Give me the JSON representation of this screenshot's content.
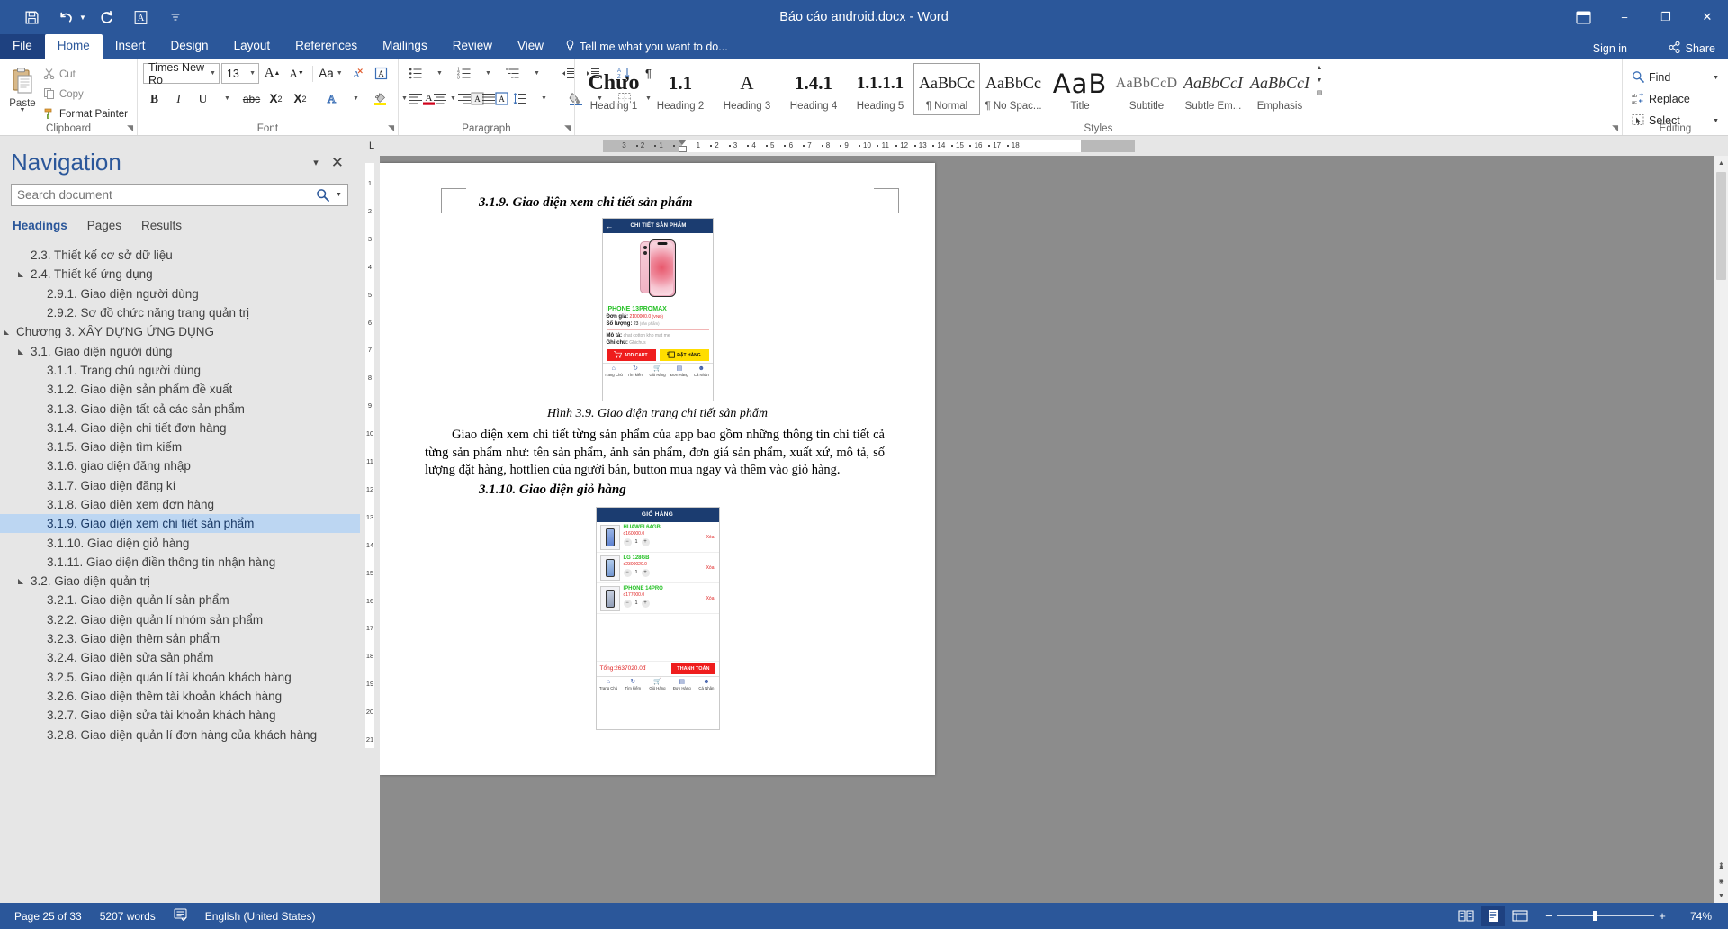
{
  "window": {
    "title": "Báo cáo android.docx - Word",
    "quick_access": [
      "save-icon",
      "undo-icon",
      "redo-icon",
      "style-a-icon",
      "customize-qat-icon"
    ],
    "ribbon_display_icon": "ribbon-display-options-icon",
    "minimize": "−",
    "restore": "❐",
    "close": "✕"
  },
  "tabs": {
    "items": [
      "File",
      "Home",
      "Insert",
      "Design",
      "Layout",
      "References",
      "Mailings",
      "Review",
      "View"
    ],
    "active": "Home",
    "tell_me": "Tell me what you want to do...",
    "sign_in": "Sign in",
    "share": "Share"
  },
  "ribbon": {
    "groups": [
      "Clipboard",
      "Font",
      "Paragraph",
      "Styles",
      "Editing"
    ],
    "clipboard": {
      "paste_label": "Paste",
      "cut": "Cut",
      "copy": "Copy",
      "format_painter": "Format Painter"
    },
    "font": {
      "font_name": "Times New Ro",
      "font_size": "13",
      "grow_font": "A",
      "shrink_font": "A",
      "change_case": "Aa",
      "clear_formatting": "clear-formatting-icon",
      "bold": "B",
      "italic": "I",
      "underline": "U",
      "strikethrough": "abc",
      "subscript": "X₂",
      "superscript": "X²",
      "text_effects": "A",
      "highlight": "ab",
      "font_color": "A",
      "char_shading": "A",
      "char_border": "A"
    },
    "paragraph": {
      "bullets": "bullets-icon",
      "numbering": "numbering-icon",
      "multilevel": "multilevel-list-icon",
      "decrease_indent": "decrease-indent-icon",
      "increase_indent": "increase-indent-icon",
      "sort": "sort-icon",
      "show_marks": "¶",
      "align_left": "align-left-icon",
      "align_center": "align-center-icon",
      "align_right": "align-right-icon",
      "justify": "justify-icon",
      "line_spacing": "line-spacing-icon",
      "shading": "shading-icon",
      "borders": "borders-icon"
    },
    "styles": [
      {
        "preview": "Chưo",
        "name": "Heading 1",
        "selected": false
      },
      {
        "preview": "1.1",
        "name": "Heading 2",
        "selected": false
      },
      {
        "preview": "A",
        "name": "Heading 3",
        "selected": false
      },
      {
        "preview": "1.4.1",
        "name": "Heading 4",
        "selected": false
      },
      {
        "preview": "1.1.1.1",
        "name": "Heading 5",
        "selected": false
      },
      {
        "preview": "AaBbCc",
        "name": "¶ Normal",
        "selected": true
      },
      {
        "preview": "AaBbCc",
        "name": "¶ No Spac...",
        "selected": false
      },
      {
        "preview": "AaB",
        "name": "Title",
        "selected": false
      },
      {
        "preview": "AaBbCcD",
        "name": "Subtitle",
        "selected": false
      },
      {
        "preview": "AaBbCcI",
        "name": "Subtle Em...",
        "selected": false
      },
      {
        "preview": "AaBbCcI",
        "name": "Emphasis",
        "selected": false
      }
    ],
    "editing": {
      "find": "Find",
      "replace": "Replace",
      "select": "Select"
    }
  },
  "navigation": {
    "title": "Navigation",
    "search_placeholder": "Search document",
    "search_value": "",
    "tabs": [
      "Headings",
      "Pages",
      "Results"
    ],
    "active_tab": "Headings",
    "items": [
      {
        "label": "2.3. Thiết kế cơ sở dữ liệu",
        "level": 2,
        "arrow": false,
        "selected": false
      },
      {
        "label": "2.4. Thiết kế ứng dụng",
        "level": 2,
        "arrow": true,
        "selected": false
      },
      {
        "label": "2.9.1. Giao diện người dùng",
        "level": 3,
        "arrow": false,
        "selected": false
      },
      {
        "label": "2.9.2. Sơ đồ chức năng trang quản trị",
        "level": 3,
        "arrow": false,
        "selected": false
      },
      {
        "label": "Chương 3. XÂY DỰNG ỨNG DỤNG",
        "level": 1,
        "arrow": true,
        "selected": false
      },
      {
        "label": "3.1. Giao diện người dùng",
        "level": 2,
        "arrow": true,
        "selected": false
      },
      {
        "label": "3.1.1. Trang chủ người dùng",
        "level": 3,
        "arrow": false,
        "selected": false
      },
      {
        "label": "3.1.2. Giao diện sản phẩm đề xuất",
        "level": 3,
        "arrow": false,
        "selected": false
      },
      {
        "label": "3.1.3. Giao diện tất cả các sản phẩm",
        "level": 3,
        "arrow": false,
        "selected": false
      },
      {
        "label": "3.1.4. Giao diện chi tiết đơn hàng",
        "level": 3,
        "arrow": false,
        "selected": false
      },
      {
        "label": "3.1.5. Giao diện tìm kiếm",
        "level": 3,
        "arrow": false,
        "selected": false
      },
      {
        "label": "3.1.6. giao diện đăng nhập",
        "level": 3,
        "arrow": false,
        "selected": false
      },
      {
        "label": "3.1.7. Giao diện đăng kí",
        "level": 3,
        "arrow": false,
        "selected": false
      },
      {
        "label": "3.1.8. Giao diện xem đơn hàng",
        "level": 3,
        "arrow": false,
        "selected": false
      },
      {
        "label": "3.1.9. Giao diện xem chi tiết sản phẩm",
        "level": 3,
        "arrow": false,
        "selected": true
      },
      {
        "label": "3.1.10. Giao diện giỏ hàng",
        "level": 3,
        "arrow": false,
        "selected": false
      },
      {
        "label": "3.1.11. Giao diện điền thông tin nhận hàng",
        "level": 3,
        "arrow": false,
        "selected": false
      },
      {
        "label": "3.2. Giao diện quản trị",
        "level": 2,
        "arrow": true,
        "selected": false
      },
      {
        "label": "3.2.1. Giao diện quản lí sản phẩm",
        "level": 3,
        "arrow": false,
        "selected": false
      },
      {
        "label": "3.2.2. Giao diện quản lí nhóm sản phẩm",
        "level": 3,
        "arrow": false,
        "selected": false
      },
      {
        "label": "3.2.3. Giao diện thêm sản phẩm",
        "level": 3,
        "arrow": false,
        "selected": false
      },
      {
        "label": "3.2.4. Giao diện sửa sản phẩm",
        "level": 3,
        "arrow": false,
        "selected": false
      },
      {
        "label": "3.2.5. Giao diện quản lí tài khoản khách hàng",
        "level": 3,
        "arrow": false,
        "selected": false
      },
      {
        "label": "3.2.6. Giao diện thêm tài khoản khách hàng",
        "level": 3,
        "arrow": false,
        "selected": false
      },
      {
        "label": "3.2.7. Giao diện sửa tài khoản khách hàng",
        "level": 3,
        "arrow": false,
        "selected": false
      },
      {
        "label": "3.2.8. Giao diện quản lí đơn hàng của khách hàng",
        "level": 3,
        "arrow": false,
        "selected": false
      }
    ]
  },
  "ruler": {
    "corner_icon": "L",
    "h_ticks": [
      "3",
      "2",
      "1",
      "1",
      "2",
      "3",
      "4",
      "5",
      "6",
      "7",
      "8",
      "9",
      "10",
      "11",
      "12",
      "13",
      "14",
      "15",
      "16",
      "17",
      "18"
    ],
    "v_ticks": [
      "1",
      "2",
      "3",
      "4",
      "5",
      "6",
      "7",
      "8",
      "9",
      "10",
      "11",
      "12",
      "13",
      "14",
      "15",
      "16",
      "17",
      "18",
      "19",
      "20",
      "21"
    ]
  },
  "document": {
    "heading_1": "3.1.9. Giao diện xem chi tiết sản phẩm",
    "caption_1": "Hình 3.9. Giao diện trang chi tiết sản phẩm",
    "paragraph_1": "Giao diện xem chi tiết từng sản phẩm của app bao gồm những thông tin chi tiết cả từng sản phẩm như: tên sản phẩm, ảnh sản phẩm, đơn giá sản phẩm, xuất xứ, mô tả, số lượng đặt hàng, hottlien của người bán, button mua ngay và thêm vào giỏ hàng.",
    "heading_2": "3.1.10. Giao diện giỏ hàng",
    "detail_mockup": {
      "appbar_title": "CHI TIẾT SẢN PHẨM",
      "back_icon": "back-arrow-icon",
      "product_name": "IPHONE 13PROMAX",
      "price_label": "Đơn giá:",
      "price_value": "2100000.0",
      "price_unit": "(VNĐ)",
      "qty_label": "Số lượng:",
      "qty_value": "23",
      "qty_unit": "(sản phẩm)",
      "desc_label": "Mô tả:",
      "desc_value": "chat cotton kho mat me",
      "note_label": "Ghi chú:",
      "note_value": "Ghichus",
      "btn_cart": "ADD CART",
      "btn_order": "ĐẶT HÀNG",
      "nav": [
        "Trang Chủ",
        "Tìm kiếm",
        "Giỏ Hàng",
        "Đơn Hàng",
        "Cá Nhân"
      ]
    },
    "cart_mockup": {
      "appbar_title": "GIỎ HÀNG",
      "items": [
        {
          "name": "HUAWEI 64GB",
          "price": "đ160000.0",
          "qty": "1",
          "delete": "Xóa"
        },
        {
          "name": "LG 128GB",
          "price": "đ2300020.0",
          "qty": "1",
          "delete": "Xóa"
        },
        {
          "name": "IPHONE 14PRO",
          "price": "đ177000.0",
          "qty": "1",
          "delete": "Xóa"
        }
      ],
      "total": "Tổng:2637020.0đ",
      "checkout": "THANH TOÁN",
      "nav": [
        "Trang Chủ",
        "Tìm kiếm",
        "Giỏ Hàng",
        "Đơn Hàng",
        "Cá Nhân"
      ]
    }
  },
  "statusbar": {
    "page": "Page 25 of 33",
    "words": "5207 words",
    "proofing_icon": "proofing-errors-icon",
    "language": "English (United States)",
    "view_read": "read-mode-icon",
    "view_print": "print-layout-icon",
    "view_web": "web-layout-icon",
    "zoom_out": "−",
    "zoom_in": "+",
    "zoom_level": "74%"
  }
}
